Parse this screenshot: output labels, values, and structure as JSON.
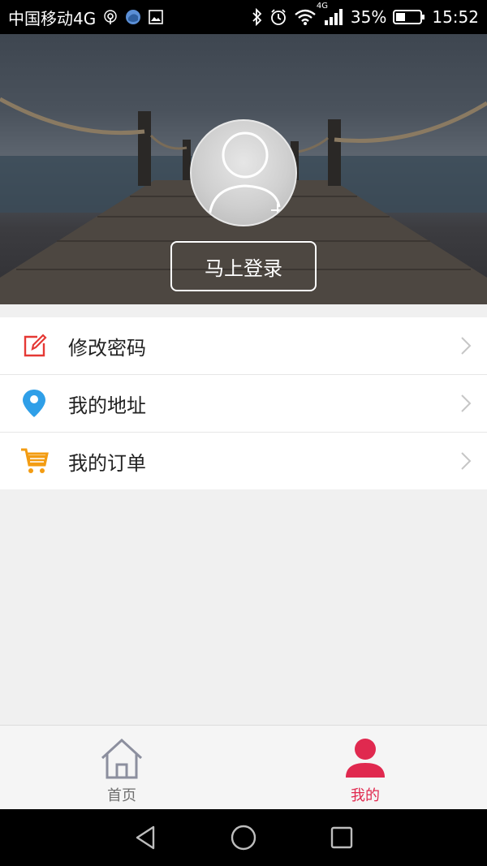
{
  "status_bar": {
    "carrier": "中国移动4G",
    "battery": "35%",
    "time": "15:52",
    "network_badge": "4G"
  },
  "header": {
    "avatar_icon": "user-avatar-icon",
    "login_label": "马上登录"
  },
  "menu": {
    "items": [
      {
        "label": "修改密码",
        "icon": "edit-icon",
        "color": "#e53935"
      },
      {
        "label": "我的地址",
        "icon": "location-pin-icon",
        "color": "#2f9fe8"
      },
      {
        "label": "我的订单",
        "icon": "shopping-cart-icon",
        "color": "#f39c12"
      }
    ]
  },
  "tabbar": {
    "tabs": [
      {
        "label": "首页",
        "icon": "home-icon",
        "active": false
      },
      {
        "label": "我的",
        "icon": "person-icon",
        "active": true
      }
    ],
    "active_color": "#e0294f"
  }
}
